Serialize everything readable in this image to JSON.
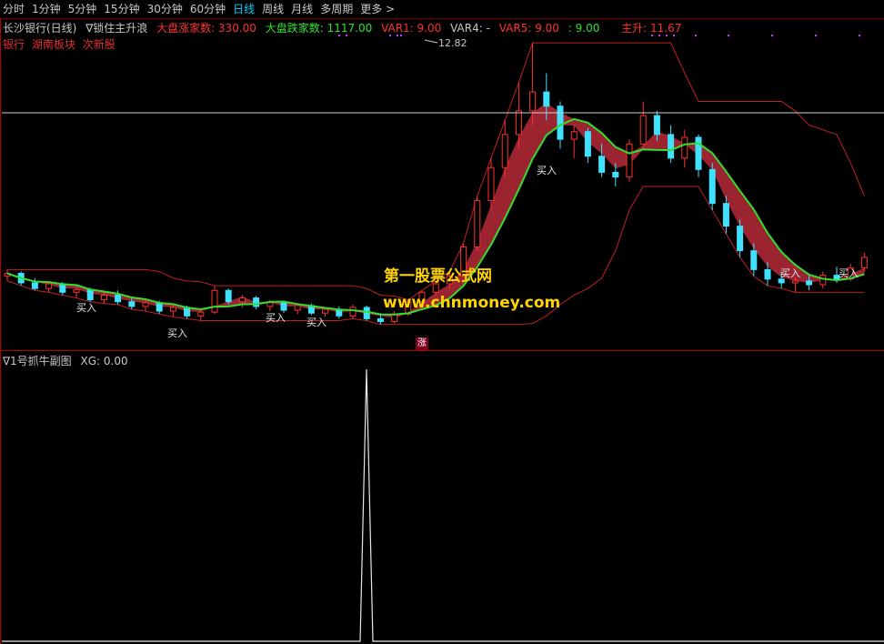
{
  "toolbar": {
    "items": [
      "分时",
      "1分钟",
      "5分钟",
      "15分钟",
      "30分钟",
      "60分钟",
      "日线",
      "周线",
      "月线",
      "多周期",
      "更多 >"
    ],
    "active_index": 6
  },
  "info": {
    "stock_title": "长沙银行(日线)",
    "indicator_name": "∇锁住主升浪",
    "up_count_label": "大盘涨家数: 330.00",
    "down_count_label": "大盘跌家数: 1117.00",
    "var1_label": "VAR1: 9.00",
    "var4_label": "VAR4: -",
    "var5_label": "VAR5: 9.00",
    "var6_label": ": 9.00",
    "main_rise_label": "主升: 11.67"
  },
  "tags": [
    "银行",
    "湖南板块",
    "次新股"
  ],
  "chart": {
    "peak_label": "12.82",
    "badge": "涨",
    "buy_text": "买入"
  },
  "sub_chart": {
    "name": "∇1号抓牛副图",
    "xg_label": "XG: 0.00"
  },
  "watermark": {
    "line1": "第一股票公式网",
    "line2": "www.chnmoney.com"
  },
  "colors": {
    "up": "#ff3030",
    "down": "#40e0ff",
    "band_fill": "#d03040",
    "green_line": "#30e030",
    "envelope": "#c02020",
    "up_text": "#ff3030",
    "down_text": "#30e030"
  },
  "chart_data": {
    "type": "candlestick",
    "candles": [
      [
        10.35,
        10.42,
        10.3,
        10.38
      ],
      [
        10.38,
        10.4,
        10.25,
        10.28
      ],
      [
        10.28,
        10.33,
        10.2,
        10.22
      ],
      [
        10.22,
        10.3,
        10.18,
        10.27
      ],
      [
        10.27,
        10.29,
        10.15,
        10.18
      ],
      [
        10.18,
        10.24,
        10.12,
        10.21
      ],
      [
        10.21,
        10.23,
        10.08,
        10.1
      ],
      [
        10.1,
        10.18,
        10.06,
        10.15
      ],
      [
        10.15,
        10.2,
        10.05,
        10.08
      ],
      [
        10.08,
        10.12,
        10.0,
        10.03
      ],
      [
        10.03,
        10.1,
        9.98,
        10.07
      ],
      [
        10.07,
        10.09,
        9.95,
        9.98
      ],
      [
        9.98,
        10.05,
        9.92,
        10.02
      ],
      [
        10.02,
        10.04,
        9.9,
        9.93
      ],
      [
        9.93,
        10.0,
        9.88,
        9.97
      ],
      [
        9.97,
        10.25,
        9.95,
        10.2
      ],
      [
        10.2,
        10.22,
        10.05,
        10.08
      ],
      [
        10.08,
        10.15,
        10.02,
        10.12
      ],
      [
        10.12,
        10.14,
        10.0,
        10.03
      ],
      [
        10.03,
        10.1,
        9.98,
        10.07
      ],
      [
        10.07,
        10.09,
        9.96,
        9.99
      ],
      [
        9.99,
        10.06,
        9.95,
        10.04
      ],
      [
        10.04,
        10.06,
        9.94,
        9.96
      ],
      [
        9.96,
        10.02,
        9.92,
        10.0
      ],
      [
        10.0,
        10.03,
        9.9,
        9.93
      ],
      [
        9.93,
        10.05,
        9.9,
        10.02
      ],
      [
        10.02,
        10.04,
        9.88,
        9.9
      ],
      [
        9.9,
        9.96,
        9.84,
        9.87
      ],
      [
        9.87,
        9.98,
        9.85,
        9.95
      ],
      [
        9.95,
        10.1,
        9.93,
        10.08
      ],
      [
        10.08,
        10.2,
        10.05,
        10.18
      ],
      [
        10.18,
        10.3,
        10.15,
        10.27
      ],
      [
        10.27,
        10.4,
        10.22,
        10.35
      ],
      [
        10.35,
        10.7,
        10.33,
        10.66
      ],
      [
        10.66,
        11.2,
        10.62,
        11.15
      ],
      [
        11.15,
        11.6,
        11.05,
        11.5
      ],
      [
        11.5,
        12.0,
        11.4,
        11.85
      ],
      [
        11.85,
        12.4,
        11.7,
        12.1
      ],
      [
        12.1,
        12.82,
        11.95,
        12.3
      ],
      [
        12.3,
        12.5,
        12.0,
        12.15
      ],
      [
        12.15,
        12.2,
        11.7,
        11.8
      ],
      [
        11.8,
        11.95,
        11.6,
        11.88
      ],
      [
        11.88,
        11.92,
        11.55,
        11.62
      ],
      [
        11.62,
        11.75,
        11.4,
        11.45
      ],
      [
        11.45,
        11.55,
        11.3,
        11.4
      ],
      [
        11.4,
        11.8,
        11.35,
        11.75
      ],
      [
        11.75,
        12.2,
        11.7,
        12.05
      ],
      [
        12.05,
        12.1,
        11.78,
        11.85
      ],
      [
        11.85,
        11.95,
        11.55,
        11.6
      ],
      [
        11.6,
        11.9,
        11.5,
        11.82
      ],
      [
        11.82,
        11.85,
        11.4,
        11.48
      ],
      [
        11.48,
        11.55,
        11.05,
        11.12
      ],
      [
        11.12,
        11.2,
        10.8,
        10.88
      ],
      [
        10.88,
        10.95,
        10.55,
        10.62
      ],
      [
        10.62,
        10.7,
        10.35,
        10.42
      ],
      [
        10.42,
        10.5,
        10.25,
        10.32
      ],
      [
        10.32,
        10.4,
        10.22,
        10.28
      ],
      [
        10.28,
        10.35,
        10.18,
        10.3
      ],
      [
        10.3,
        10.38,
        10.2,
        10.26
      ],
      [
        10.26,
        10.4,
        10.22,
        10.36
      ],
      [
        10.36,
        10.45,
        10.28,
        10.32
      ],
      [
        10.32,
        10.48,
        10.3,
        10.44
      ],
      [
        10.44,
        10.6,
        10.4,
        10.55
      ]
    ],
    "peak_value": 12.82
  }
}
